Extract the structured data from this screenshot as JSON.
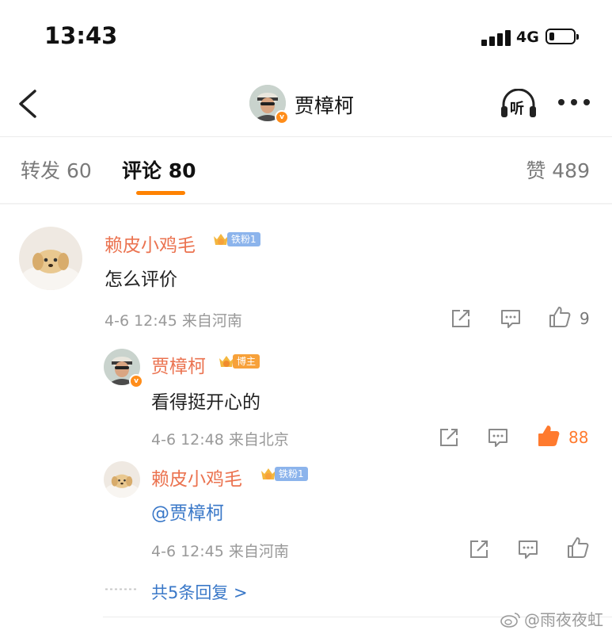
{
  "status_bar": {
    "time": "13:43",
    "network": "4G",
    "battery_level": 0.22
  },
  "nav": {
    "title": "贾樟柯",
    "listen_label": "听"
  },
  "tabs": [
    {
      "label": "转发 60"
    },
    {
      "label": "评论 80",
      "active": true
    },
    {
      "label": "赞 489"
    }
  ],
  "comment": {
    "user": "赖皮小鸡毛",
    "badge_label": "铁粉1",
    "badge_level": "2",
    "text": "怎么评价",
    "meta": "4-6 12:45 来自河南",
    "likes": "9"
  },
  "replies": [
    {
      "user": "贾樟柯",
      "badge_label": "博主",
      "text": "看得挺开心的",
      "meta": "4-6 12:48 来自北京",
      "likes": "88"
    },
    {
      "user": "赖皮小鸡毛",
      "badge_label": "铁粉1",
      "badge_level": "2",
      "text": "@贾樟柯",
      "meta": "4-6 12:45 来自河南",
      "likes": ""
    }
  ],
  "more_replies": "共5条回复 >",
  "watermark": "@雨夜夜虹",
  "colors": {
    "accent": "#ff8200",
    "username": "#eb7350",
    "like_active": "#ff7a2e",
    "link": "#3a78c8"
  }
}
